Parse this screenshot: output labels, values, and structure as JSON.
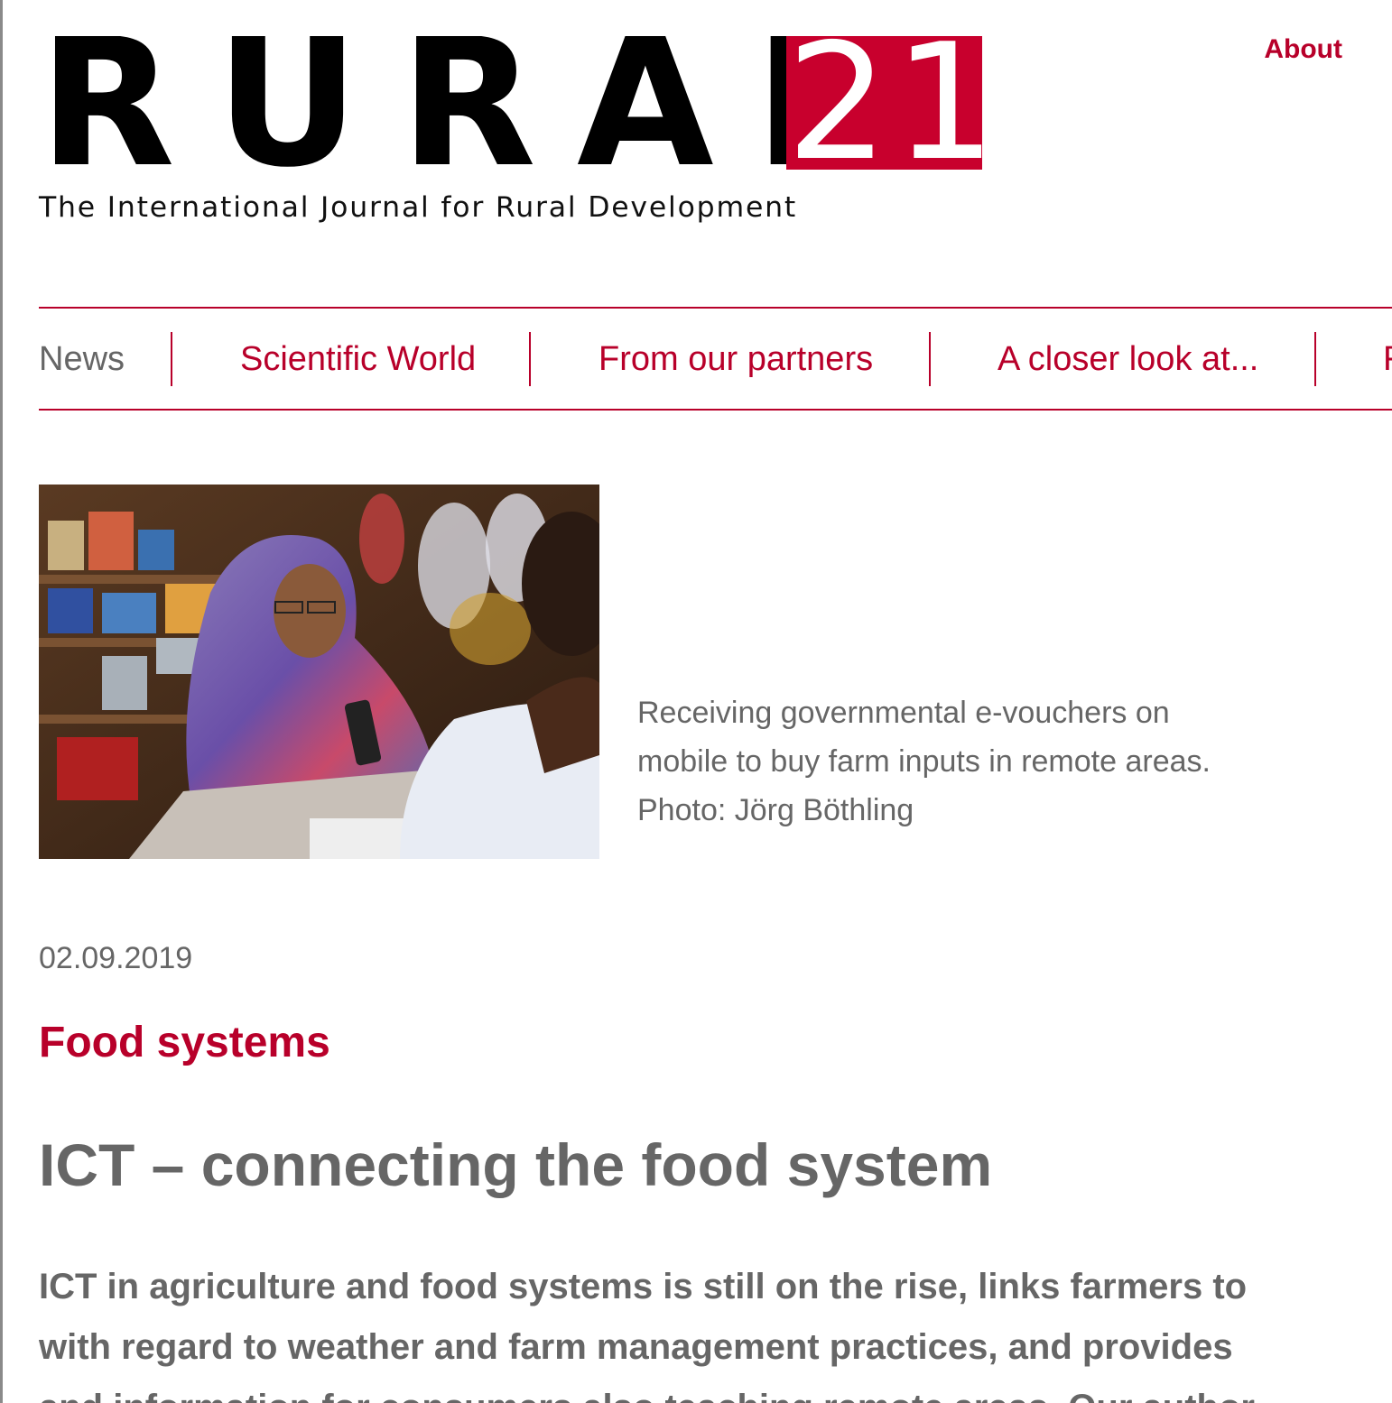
{
  "header": {
    "logo_word": "RURAL",
    "logo_number": "21",
    "tagline": "The International Journal for Rural Development",
    "about_label": "About"
  },
  "nav": {
    "items": [
      {
        "label": "News",
        "active": true
      },
      {
        "label": "Scientific World",
        "active": false
      },
      {
        "label": "From our partners",
        "active": false
      },
      {
        "label": "A closer look at...",
        "active": false
      },
      {
        "label": "F",
        "active": false
      }
    ]
  },
  "article": {
    "caption_lines": [
      "Receiving governmental e-vouchers on",
      "mobile to buy farm inputs in remote areas.",
      "Photo: Jörg Böthling"
    ],
    "date": "02.09.2019",
    "category": "Food systems",
    "title": "ICT – connecting the food system",
    "lead_lines": [
      "ICT in agriculture and food systems is still on the rise, links farmers to",
      "with regard to weather and farm management practices, and provides",
      "and information for consumers also teaching remote areas. Our author"
    ]
  },
  "colors": {
    "brand_red": "#c8002d",
    "link_red": "#b8002a",
    "text_gray": "#666666"
  }
}
